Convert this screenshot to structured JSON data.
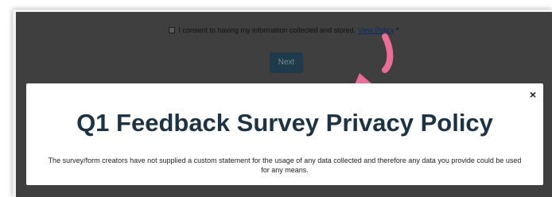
{
  "consent": {
    "label": "I consent to having my information collected and stored.",
    "link_text": "View Policy",
    "required_marker": "*",
    "checked": false
  },
  "form": {
    "next_label": "Next"
  },
  "modal": {
    "close_glyph": "×",
    "title": "Q1 Feedback Survey Privacy Policy",
    "body": "The survey/form creators have not supplied a custom statement for the usage of any data collected and therefore any data you provide could be used for any means."
  },
  "colors": {
    "backdrop": "#3f3f3f",
    "next_button": "#1f3a4a",
    "title": "#1c3345",
    "annotation_arrow": "#ec6d97"
  },
  "icons": {
    "close": "close-icon",
    "annotation": "arrow-icon"
  }
}
